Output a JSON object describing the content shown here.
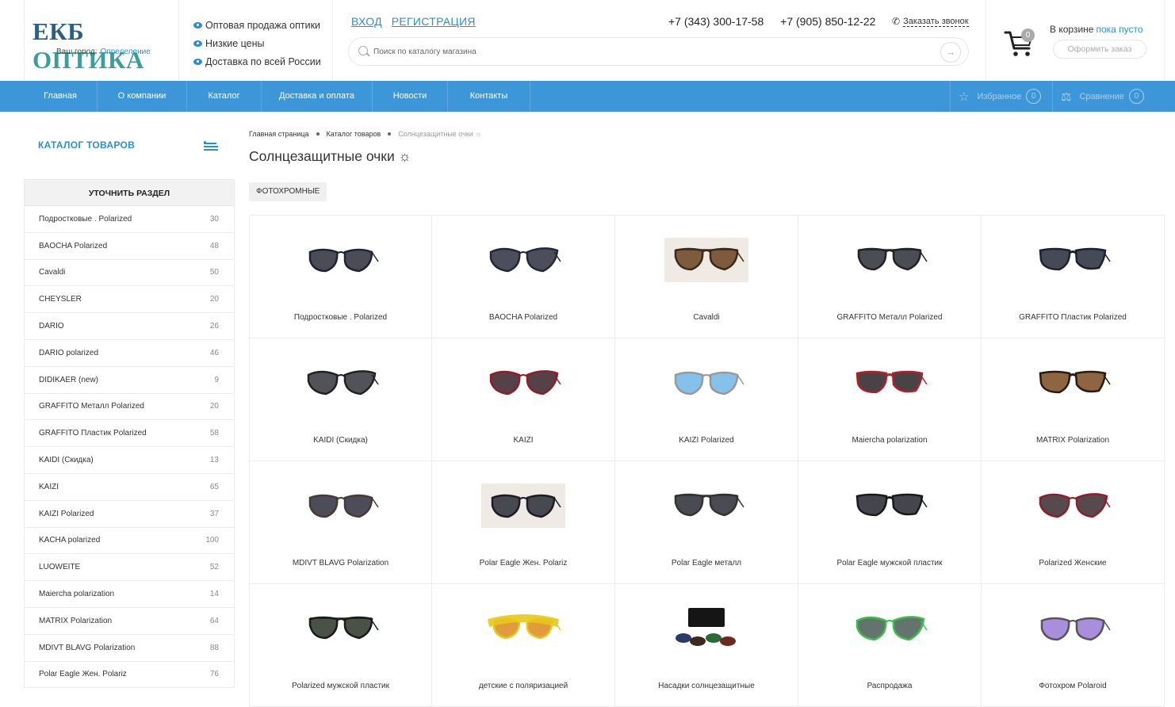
{
  "header": {
    "logo_part1": "ЕКБ",
    "logo_part2": "ОПТИКА",
    "city_label": "Ваш город:",
    "city_link": "Определение",
    "features": [
      "Оптовая продажа оптики",
      "Низкие цены",
      "Доставка по всей России"
    ],
    "login": "ВХОД",
    "register": "РЕГИСТРАЦИЯ",
    "phone1": "+7 (343) 300-17-58",
    "phone2": "+7 (905) 850-12-22",
    "callback": "Заказать звонок",
    "search_placeholder": "Поиск по каталогу магазина",
    "cart_count": "0",
    "cart_label": "В корзине",
    "cart_status": "пока пусто",
    "order_button": "Оформить заказ"
  },
  "nav": {
    "items": [
      "Главная",
      "О компании",
      "Каталог",
      "Доставка и оплата",
      "Новости",
      "Контакты"
    ],
    "favorites_label": "Избранное",
    "favorites_count": "0",
    "compare_label": "Сравнение",
    "compare_count": "0"
  },
  "sidebar": {
    "catalog_title": "КАТАЛОГ ТОВАРОВ",
    "section_title": "УТОЧНИТЬ РАЗДЕЛ",
    "items": [
      {
        "label": "Подростковые . Polarized",
        "count": "30"
      },
      {
        "label": "BAOCHA Polarized",
        "count": "48"
      },
      {
        "label": "Cavaldi",
        "count": "50"
      },
      {
        "label": "CHEYSLER",
        "count": "20"
      },
      {
        "label": "DARIO",
        "count": "26"
      },
      {
        "label": "DARIO polarized",
        "count": "46"
      },
      {
        "label": "DIDIKAER (new)",
        "count": "9"
      },
      {
        "label": "GRAFFITO Металл Polarized",
        "count": "20"
      },
      {
        "label": "GRAFFITO Пластик Polarized",
        "count": "58"
      },
      {
        "label": "KAIDI (Скидка)",
        "count": "13"
      },
      {
        "label": "KAIZI",
        "count": "65"
      },
      {
        "label": "KAIZI Polarized",
        "count": "37"
      },
      {
        "label": "KACHA polarized",
        "count": "100"
      },
      {
        "label": "LUOWEITE",
        "count": "52"
      },
      {
        "label": "Maiercha polarization",
        "count": "14"
      },
      {
        "label": "MATRIX Polarization",
        "count": "64"
      },
      {
        "label": "MDIVT BLAVG Polarization",
        "count": "88"
      },
      {
        "label": "Polar Eagle Жен. Polariz",
        "count": "76"
      }
    ]
  },
  "breadcrumb": [
    "Главная страница",
    "Каталог товаров",
    "Солнцезащитные очки ☼"
  ],
  "page_title": "Солнцезащитные очки ☼",
  "filter_tag": "ФОТОХРОМНЫЕ",
  "products": [
    {
      "name": "Подростковые . Polarized",
      "lens": "#2b2d38",
      "frame": "#1f2230",
      "style": "round",
      "photo": false
    },
    {
      "name": "BAOCHA Polarized",
      "lens": "#2e2f40",
      "frame": "#24263a",
      "style": "cat",
      "photo": false
    },
    {
      "name": "Cavaldi",
      "lens": "#6a4220",
      "frame": "#3a2a1c",
      "style": "aviator",
      "photo": true
    },
    {
      "name": "GRAFFITO Металл Polarized",
      "lens": "#2c2e36",
      "frame": "#222",
      "style": "aviator",
      "photo": false
    },
    {
      "name": "GRAFFITO Пластик Polarized",
      "lens": "#262a3a",
      "frame": "#1c2030",
      "style": "square",
      "photo": false
    },
    {
      "name": "KAIDI (Скидка)",
      "lens": "#34353c",
      "frame": "#222",
      "style": "cat",
      "photo": false
    },
    {
      "name": "KAIZI",
      "lens": "#3a2028",
      "frame": "#8c1f2a",
      "style": "cat",
      "photo": false
    },
    {
      "name": "KAIZI Polarized",
      "lens": "#6fb6e8",
      "frame": "#999",
      "style": "round",
      "photo": false
    },
    {
      "name": "Maiercha polarization",
      "lens": "#2a2226",
      "frame": "#b3202a",
      "style": "square",
      "photo": false
    },
    {
      "name": "MATRIX Polarization",
      "lens": "#7a4a20",
      "frame": "#2a1a12",
      "style": "square",
      "photo": false
    },
    {
      "name": "MDIVT BLAVG Polarization",
      "lens": "#2c2e3c",
      "frame": "#4a3a36",
      "style": "round",
      "photo": false
    },
    {
      "name": "Polar Eagle Жен. Polariz",
      "lens": "#2a2c36",
      "frame": "#1c1c22",
      "style": "round",
      "photo": true
    },
    {
      "name": "Polar Eagle металл",
      "lens": "#2a2c34",
      "frame": "#333",
      "style": "aviator",
      "photo": false
    },
    {
      "name": "Polar Eagle мужской пластик",
      "lens": "#24262e",
      "frame": "#1a1a1e",
      "style": "square",
      "photo": false
    },
    {
      "name": "Polarized Женские",
      "lens": "#3a2a30",
      "frame": "#8c1f2a",
      "style": "cat",
      "photo": false
    },
    {
      "name": "Polarized мужской пластик",
      "lens": "#2a3226",
      "frame": "#1a1a1a",
      "style": "aviator",
      "photo": false
    },
    {
      "name": "детские с поляризацией",
      "lens": "#d98a1a",
      "frame": "#e8c81a",
      "style": "kids",
      "photo": false
    },
    {
      "name": "Насадки солнцезащитные",
      "lens": "#2a2c34",
      "frame": "#1a1a1a",
      "style": "clip",
      "photo": false
    },
    {
      "name": "Распродажа",
      "lens": "#4a5a56",
      "frame": "#3cbf4a",
      "style": "cat",
      "photo": false
    },
    {
      "name": "Фотохром Polaroid",
      "lens": "#9a7ad8",
      "frame": "#555",
      "style": "round",
      "photo": false
    }
  ]
}
